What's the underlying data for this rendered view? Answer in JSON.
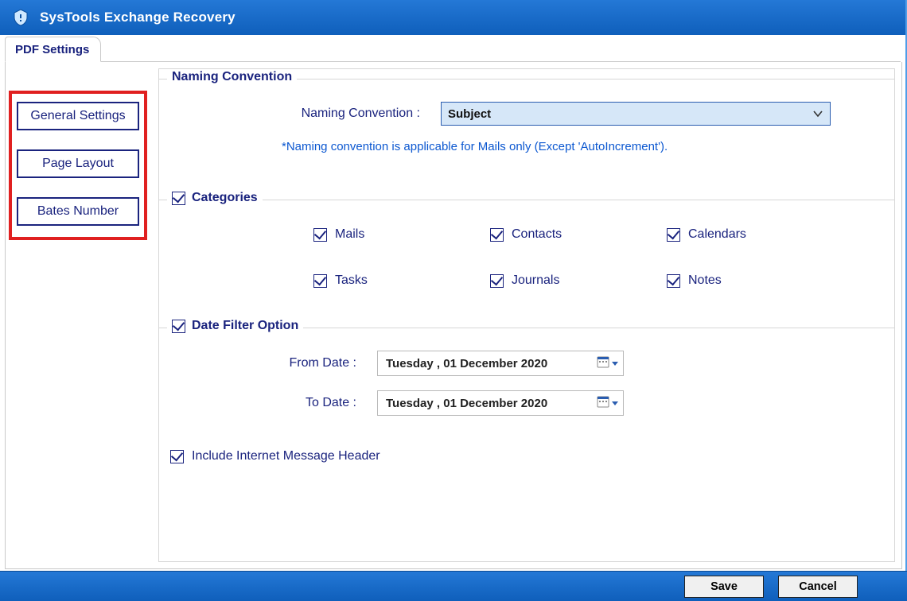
{
  "window": {
    "title": "SysTools Exchange Recovery"
  },
  "tab": {
    "label": "PDF Settings"
  },
  "sidebar": {
    "general": "General Settings",
    "page_layout": "Page Layout",
    "bates": "Bates Number"
  },
  "naming": {
    "group_title": "Naming Convention",
    "label": "Naming Convention :",
    "selected": "Subject",
    "note": "*Naming convention is applicable for Mails only (Except 'AutoIncrement')."
  },
  "categories": {
    "group_title": "Categories",
    "mails": "Mails",
    "contacts": "Contacts",
    "calendars": "Calendars",
    "tasks": "Tasks",
    "journals": "Journals",
    "notes": "Notes"
  },
  "datefilter": {
    "group_title": "Date Filter Option",
    "from_label": "From Date   :",
    "to_label": "To Date   :",
    "from_value": "Tuesday  , 01 December 2020",
    "to_value": "Tuesday  , 01 December 2020"
  },
  "imh": {
    "label": "Include Internet Message Header"
  },
  "footer": {
    "save": "Save",
    "cancel": "Cancel"
  }
}
